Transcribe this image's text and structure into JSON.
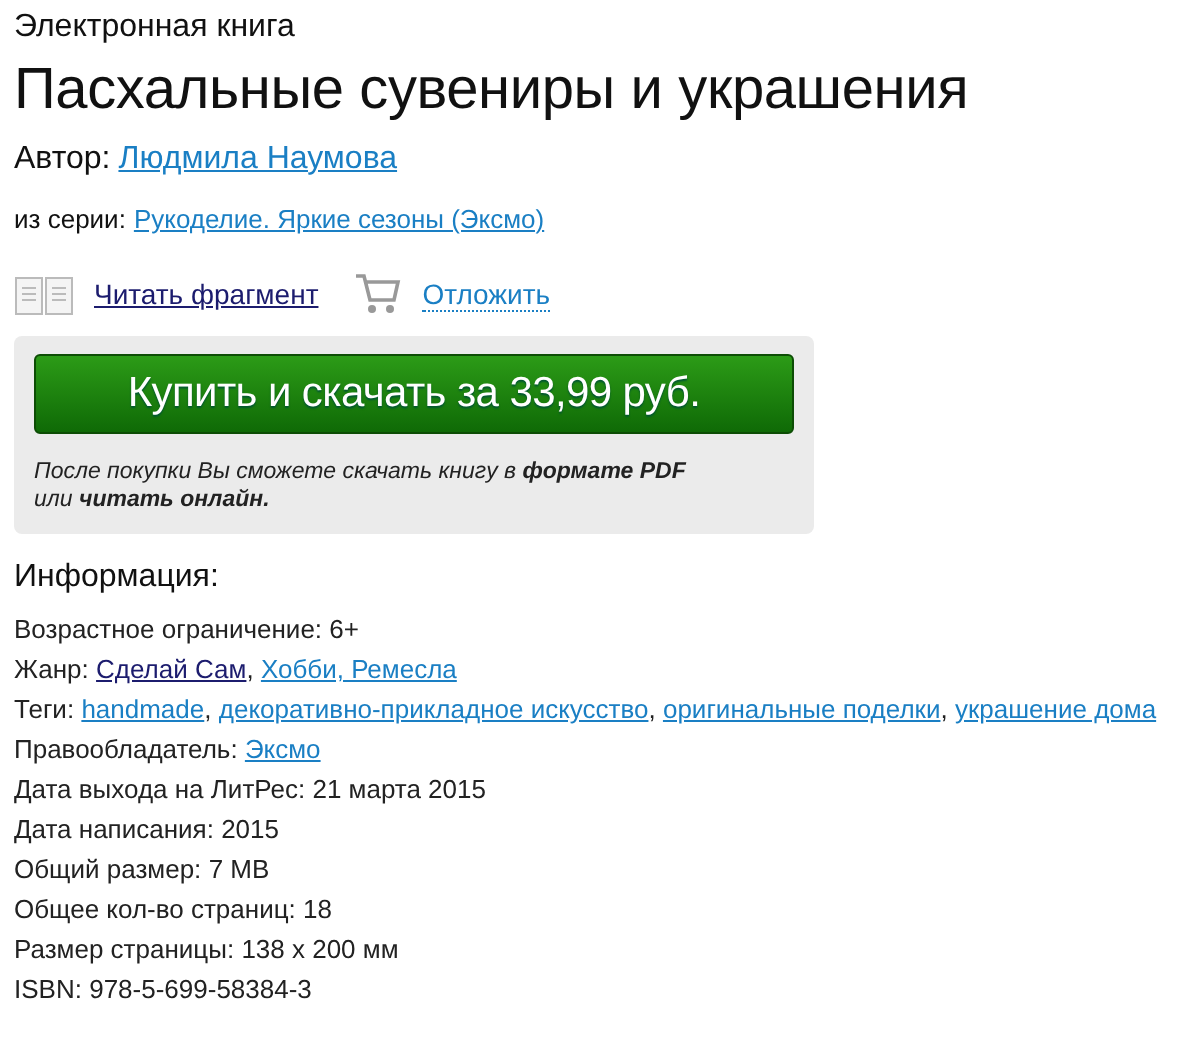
{
  "type_label": "Электронная книга",
  "title": "Пасхальные сувениры и украшения",
  "author": {
    "label": "Автор:",
    "link": {
      "text": "Людмила Наумова",
      "visited": false
    }
  },
  "series": {
    "label": "из серии:",
    "link": {
      "text": "Рукоделие. Яркие сезоны (Эксмо)",
      "visited": false
    }
  },
  "actions": [
    {
      "kind": "read",
      "text": "Читать фрагмент",
      "visited": true
    },
    {
      "kind": "cart",
      "text": "Отложить",
      "visited": false
    }
  ],
  "purchase": {
    "button": "Купить и скачать за 33,99 руб.",
    "note": "После покупки Вы сможете скачать книгу в **формате PDF** или **читать онлайн.**"
  },
  "info": {
    "heading": "Информация:",
    "rows": [
      {
        "kind": "text",
        "label": "Возрастное ограничение:",
        "value": "6+"
      },
      {
        "kind": "links",
        "label": "Жанр:",
        "separator": ",",
        "links": [
          {
            "text": "Сделай Сам",
            "visited": true
          },
          {
            "text": "Хобби, Ремесла",
            "visited": false
          }
        ]
      },
      {
        "kind": "links",
        "label": "Теги:",
        "separator": ",",
        "links": [
          {
            "text": "handmade",
            "visited": false
          },
          {
            "text": "декоративно-прикладное искусство",
            "visited": false
          },
          {
            "text": "оригинальные поделки",
            "visited": false
          },
          {
            "text": "украшение дома",
            "visited": false
          }
        ]
      },
      {
        "kind": "links",
        "label": "Правообладатель:",
        "links": [
          {
            "text": "Эксмо",
            "visited": false
          }
        ]
      },
      {
        "kind": "text",
        "label": "Дата выхода на ЛитРес:",
        "value": "21 марта 2015"
      },
      {
        "kind": "text",
        "label": "Дата написания:",
        "value": "2015"
      },
      {
        "kind": "text",
        "label": "Общий размер:",
        "value": "7 MB"
      },
      {
        "kind": "text",
        "label": "Общее кол-во страниц:",
        "value": "18"
      },
      {
        "kind": "text",
        "label": "Размер страницы:",
        "value": "138 x 200 мм"
      },
      {
        "kind": "text",
        "label": "ISBN:",
        "value": "978-5-699-58384-3"
      }
    ]
  }
}
